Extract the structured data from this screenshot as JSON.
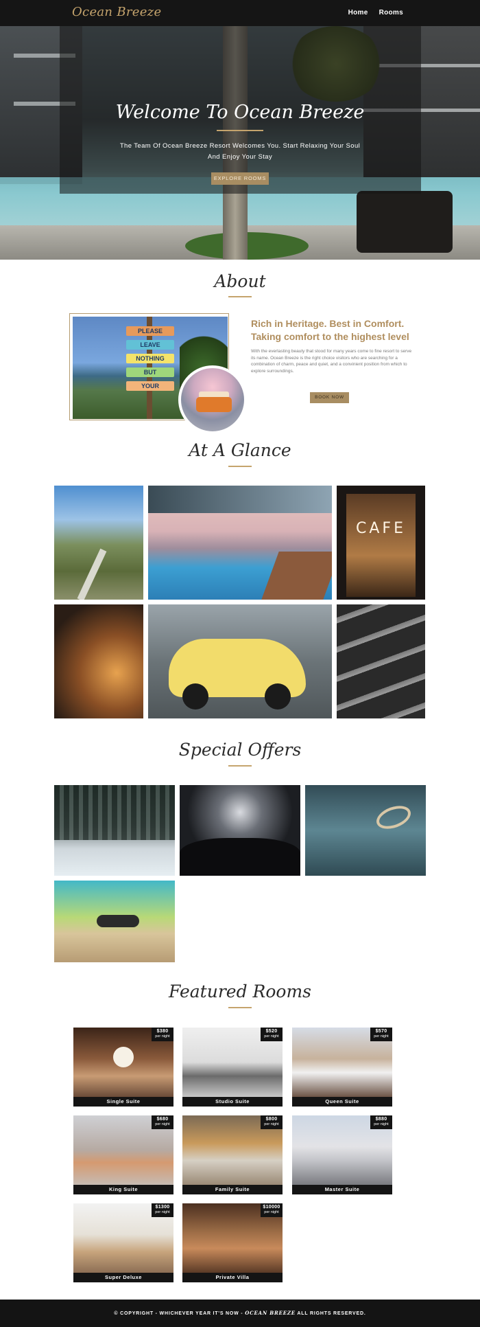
{
  "nav": {
    "brand": "Ocean Breeze",
    "links": [
      "Home",
      "Rooms"
    ]
  },
  "hero": {
    "title": "Welcome To Ocean Breeze",
    "subtitle_line1": "The Team Of Ocean Breeze Resort Welcomes You. Start Relaxing Your Soul",
    "subtitle_line2": "And Enjoy Your Stay",
    "button": "EXPLORE ROOMS"
  },
  "about": {
    "title": "About",
    "sign_words": [
      "PLEASE",
      "LEAVE",
      "NOTHING",
      "BUT",
      "YOUR"
    ],
    "heading_line1": "Rich in Heritage. Best in Comfort.",
    "heading_line2": "Taking comfort to the highest level",
    "paragraph": "With the everlasting beauty that stood for many years come to fine resort to serve its name. Ocean Breeze is the right choice visitors who are searching for a combination of charm, peace and quiet, and a convinient position from which to explore surroundings.",
    "button": "BOOK NOW"
  },
  "glance": {
    "title": "At A Glance",
    "cafe_text": "CAFE"
  },
  "offers": {
    "title": "Special Offers"
  },
  "rooms": {
    "title": "Featured Rooms",
    "per_label": "per night",
    "items": [
      {
        "name": "Single Suite",
        "price": "$380"
      },
      {
        "name": "Studio Suite",
        "price": "$520"
      },
      {
        "name": "Queen Suite",
        "price": "$570"
      },
      {
        "name": "King Suite",
        "price": "$680"
      },
      {
        "name": "Family Suite",
        "price": "$800"
      },
      {
        "name": "Master Suite",
        "price": "$880"
      },
      {
        "name": "Super Deluxe",
        "price": "$1300"
      },
      {
        "name": "Private Villa",
        "price": "$10000"
      }
    ]
  },
  "footer": {
    "prefix": "© COPYRIGHT - WHICHEVER YEAR IT'S NOW -",
    "brand": "OCEAN BREEZE",
    "suffix": "ALL RIGHTS RESERVED."
  }
}
